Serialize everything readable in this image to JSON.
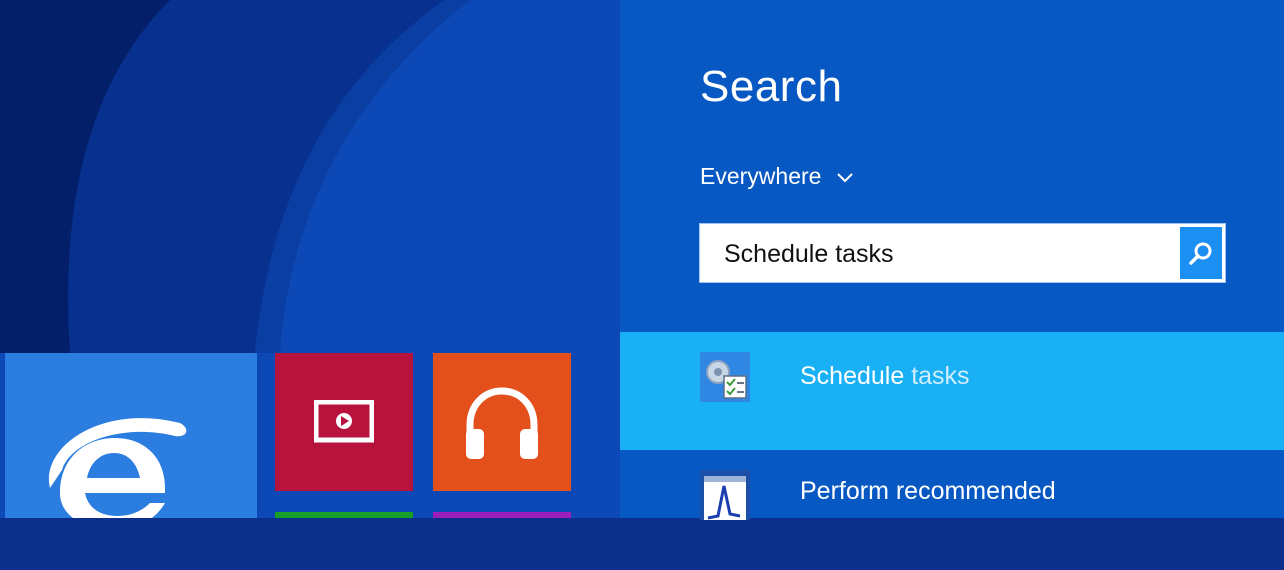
{
  "start_screen": {
    "tiles": [
      {
        "name": "internet-explorer-tile",
        "icon": "internet-explorer-icon",
        "color": "#2b7de0"
      },
      {
        "name": "video-tile",
        "icon": "video-play-icon",
        "color": "#b7133d"
      },
      {
        "name": "music-tile",
        "icon": "headphones-icon",
        "color": "#e4501b"
      },
      {
        "name": "green-tile",
        "color": "#1a9e2a"
      },
      {
        "name": "purple-tile",
        "color": "#9b1fb8"
      }
    ]
  },
  "search": {
    "title": "Search",
    "scope_label": "Everywhere",
    "scope_icon": "chevron-down-icon",
    "query": "Schedule tasks",
    "search_button_icon": "search-icon",
    "results": [
      {
        "label_main": "Schedule",
        "label_rest": " tasks",
        "icon": "task-scheduler-icon",
        "selected": true
      },
      {
        "label_main": "Perform recommended",
        "label_rest": "",
        "icon": "performance-icon",
        "selected": false
      }
    ]
  },
  "colors": {
    "pane_bg": "#0758c2",
    "selected_result": "#19b0f5",
    "search_button": "#1c8ff2"
  }
}
